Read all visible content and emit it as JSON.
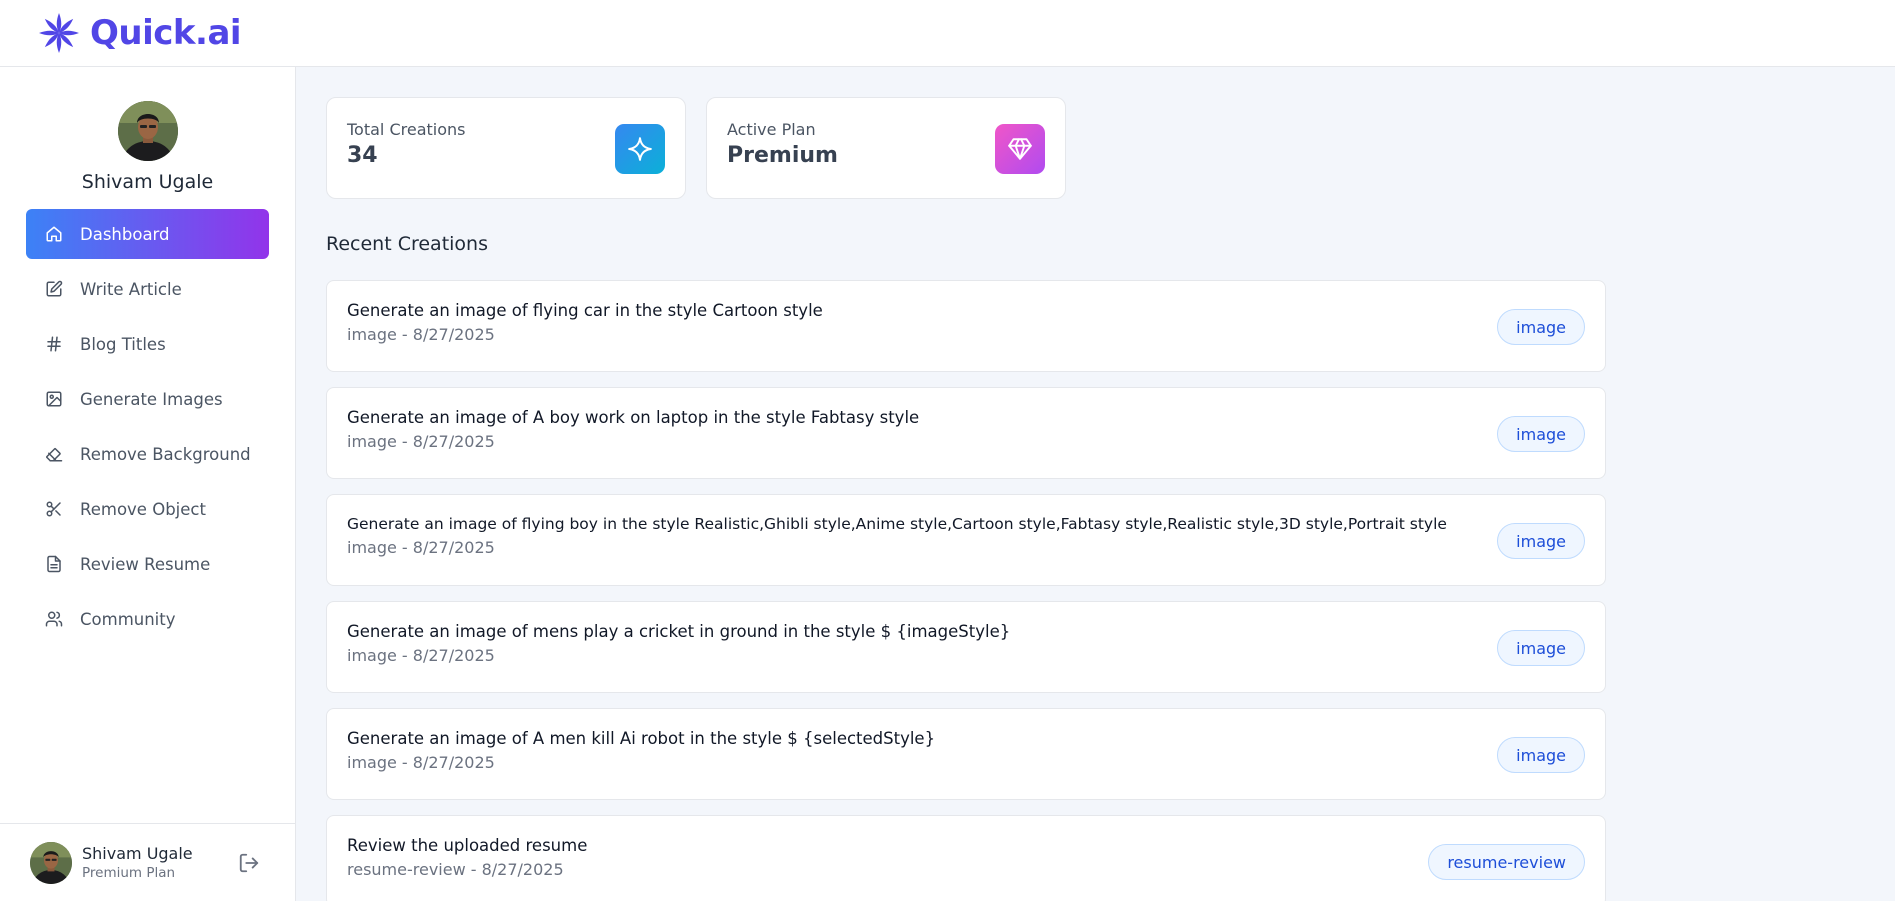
{
  "app": {
    "name": "Quick.ai",
    "brand_color": "#5146e6"
  },
  "user": {
    "name": "Shivam Ugale",
    "plan": "Premium Plan"
  },
  "sidebar": {
    "items": [
      {
        "label": "Dashboard",
        "icon": "home-icon",
        "active": true
      },
      {
        "label": "Write Article",
        "icon": "edit-icon"
      },
      {
        "label": "Blog Titles",
        "icon": "hash-icon"
      },
      {
        "label": "Generate Images",
        "icon": "image-icon"
      },
      {
        "label": "Remove Background",
        "icon": "eraser-icon"
      },
      {
        "label": "Remove Object",
        "icon": "scissors-icon"
      },
      {
        "label": "Review Resume",
        "icon": "file-text-icon"
      },
      {
        "label": "Community",
        "icon": "users-icon"
      }
    ],
    "active_gradient": [
      "#3c82f6",
      "#9234ea"
    ]
  },
  "stats": [
    {
      "label": "Total Creations",
      "value": "34",
      "icon": "sparkle-icon"
    },
    {
      "label": "Active Plan",
      "value": "Premium",
      "icon": "gem-icon"
    }
  ],
  "recent": {
    "title": "Recent Creations",
    "items": [
      {
        "prompt": "Generate an image of flying car in the style Cartoon style",
        "meta": "image - 8/27/2025",
        "type": "image"
      },
      {
        "prompt": "Generate an image of A boy work on laptop in the style Fabtasy style",
        "meta": "image - 8/27/2025",
        "type": "image"
      },
      {
        "prompt": "Generate an image of flying boy in the style Realistic,Ghibli style,Anime style,Cartoon style,Fabtasy style,Realistic style,3D style,Portrait style",
        "meta": "image - 8/27/2025",
        "type": "image"
      },
      {
        "prompt": "Generate an image of mens play a cricket in ground in the style $ {imageStyle}",
        "meta": "image - 8/27/2025",
        "type": "image"
      },
      {
        "prompt": "Generate an image of A men kill Ai robot in the style $ {selectedStyle}",
        "meta": "image - 8/27/2025",
        "type": "image"
      },
      {
        "prompt": "Review the uploaded resume",
        "meta": "resume-review - 8/27/2025",
        "type": "resume-review"
      }
    ]
  }
}
